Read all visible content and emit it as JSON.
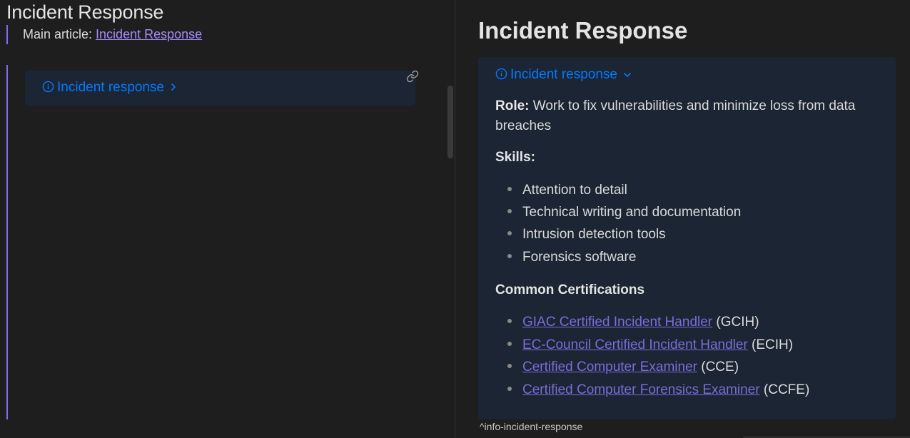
{
  "left": {
    "heading": "Incident Response",
    "main_article_prefix": "Main article: ",
    "main_article_link": "Incident Response",
    "callout_label": "Incident response"
  },
  "right": {
    "heading": "Incident Response",
    "callout_label": "Incident response",
    "role_label": "Role:",
    "role_text": " Work to fix vulnerabilities and minimize loss from data breaches",
    "skills_heading": "Skills:",
    "skills": [
      "Attention to detail",
      "Technical writing and documentation",
      "Intrusion detection tools",
      "Forensics software"
    ],
    "certs_heading": "Common Certifications",
    "certifications": [
      {
        "link": "GIAC Certified Incident Handler",
        "abbr": " (GCIH)"
      },
      {
        "link": "EC-Council Certified Incident Handler",
        "abbr": " (ECIH)"
      },
      {
        "link": "Certified Computer Examiner",
        "abbr": " (CCE)"
      },
      {
        "link": "Certified Computer Forensics Examiner",
        "abbr": " (CCFE)"
      }
    ],
    "block_id": "^info-incident-response"
  },
  "icons": {
    "info": "info-icon",
    "chevron_right": "chevron-right-icon",
    "chevron_down": "chevron-down-icon",
    "link": "link-icon"
  },
  "colors": {
    "background": "#1e1e1e",
    "callout_bg": "#1b2533",
    "callout_title": "#027aff",
    "accent": "#7f6df2",
    "link": "#7b6cd9"
  }
}
